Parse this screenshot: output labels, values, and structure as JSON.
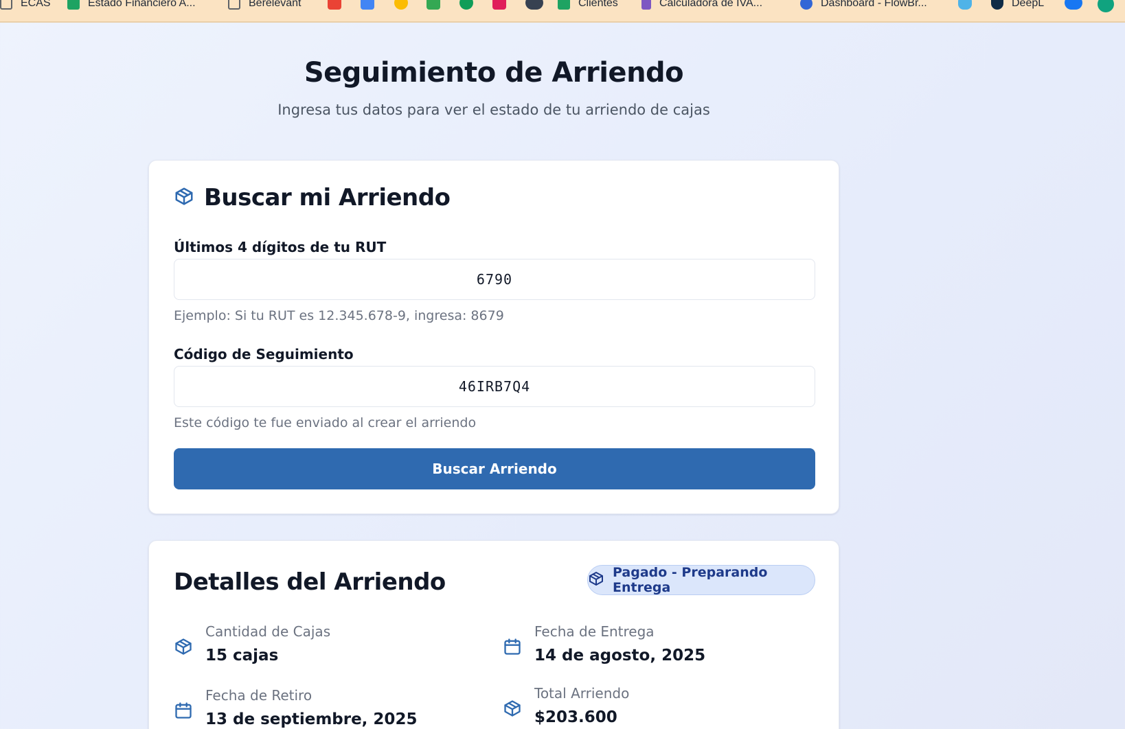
{
  "bookmarks": [
    {
      "label": "ECAS",
      "icon": "folder-icon"
    },
    {
      "label": "Estado Financiero A...",
      "icon": "sheets-icon"
    },
    {
      "label": "Berelevant",
      "icon": "folder-icon"
    },
    {
      "label": "Clientes",
      "icon": "sheets-icon"
    },
    {
      "label": "Calculadora de IVA...",
      "icon": "calculator-icon"
    },
    {
      "label": "Dashboard - FlowBr...",
      "icon": "database-icon"
    },
    {
      "label": "DeepL",
      "icon": "deepl-icon"
    }
  ],
  "header": {
    "title": "Seguimiento de Arriendo",
    "subtitle": "Ingresa tus datos para ver el estado de tu arriendo de cajas"
  },
  "search": {
    "title": "Buscar mi Arriendo",
    "rut_label": "Últimos 4 dígitos de tu RUT",
    "rut_value": "6790",
    "rut_help": "Ejemplo: Si tu RUT es 12.345.678-9, ingresa: 8679",
    "code_label": "Código de Seguimiento",
    "code_value": "46IRB7Q4",
    "code_help": "Este código te fue enviado al crear el arriendo",
    "button_label": "Buscar Arriendo"
  },
  "details": {
    "title": "Detalles del Arriendo",
    "status": "Pagado - Preparando Entrega",
    "items": [
      {
        "label": "Cantidad de Cajas",
        "value": "15 cajas",
        "icon": "box-icon"
      },
      {
        "label": "Fecha de Entrega",
        "value": "14 de agosto, 2025",
        "icon": "calendar-icon"
      },
      {
        "label": "Fecha de Retiro",
        "value": "13 de septiembre, 2025",
        "icon": "calendar-icon"
      },
      {
        "label": "Total Arriendo",
        "value": "$203.600",
        "icon": "box-icon"
      }
    ]
  },
  "colors": {
    "accent": "#2f6ab0",
    "badge_bg": "#dbe6fb",
    "badge_text": "#1e3a8a",
    "bookmarks_bar": "#fbe3c2"
  }
}
